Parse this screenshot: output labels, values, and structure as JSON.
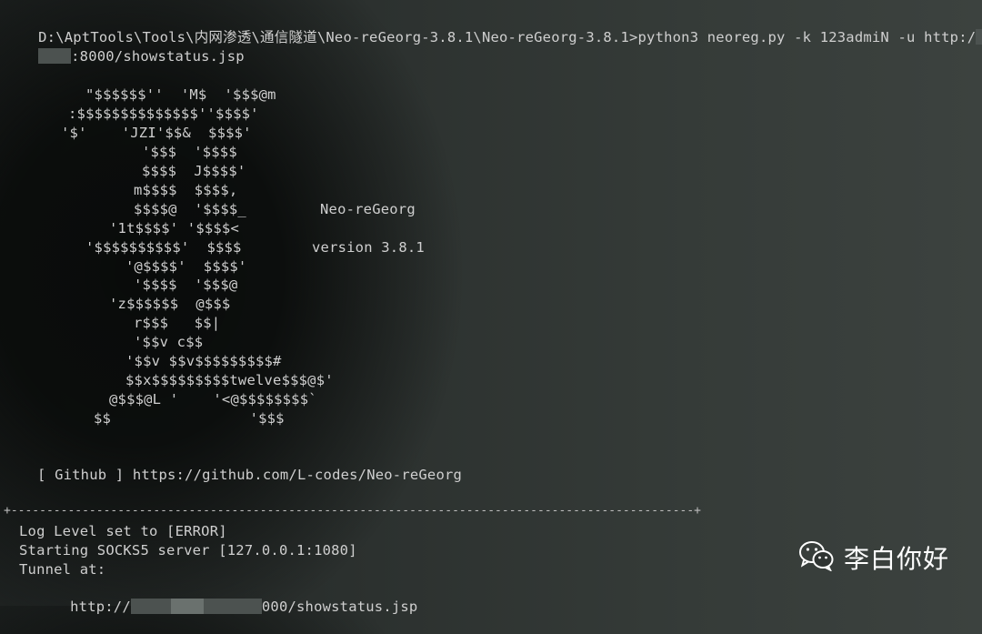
{
  "terminal": {
    "command_line_1": "D:\\AptTools\\Tools\\内网渗透\\通信隧道\\Neo-reGeorg-3.8.1\\Neo-reGeorg-3.8.1>python3 neoreg.py -k 123admiN -u http:/",
    "command_line_2": ":8000/showstatus.jsp",
    "ascii_art": [
      "\"$$$$$$''  'M$  '$$$@m",
      ":$$$$$$$$$$$$$$''$$$$'",
      "'$'    'JZI'$$&  $$$$'",
      "'$$$  '$$$$",
      "$$$$  J$$$$'",
      "m$$$$  $$$$,",
      "$$$$@  '$$$$_",
      "'1t$$$$' '$$$$<",
      "'$$$$$$$$$$'  $$$$",
      "'@$$$$'  $$$$'",
      "'$$$$  '$$$@",
      "'z$$$$$$  @$$$",
      "r$$$   $$|",
      "'$$v c$$",
      "'$$v $$v$$$$$$$$$#",
      "$$x$$$$$$$$$twelve$$$@$'",
      "@$$$@L '    '<@$$$$$$$$`",
      "$$                '$$$"
    ],
    "app_name": "Neo-reGeorg",
    "version_text": "version 3.8.1",
    "github_line": "[ Github ] https://github.com/L-codes/Neo-reGeorg",
    "separator": "+------------------------------------------------------------------------------------------------+",
    "log_level": "Log Level set to [ERROR]",
    "socks_line": "Starting SOCKS5 server [127.0.0.1:1080]",
    "tunnel_label": "Tunnel at:",
    "tunnel_prefix": "http://",
    "tunnel_suffix": "000/showstatus.jsp"
  },
  "watermark": {
    "icon": "wechat-icon",
    "text": "李白你好"
  }
}
